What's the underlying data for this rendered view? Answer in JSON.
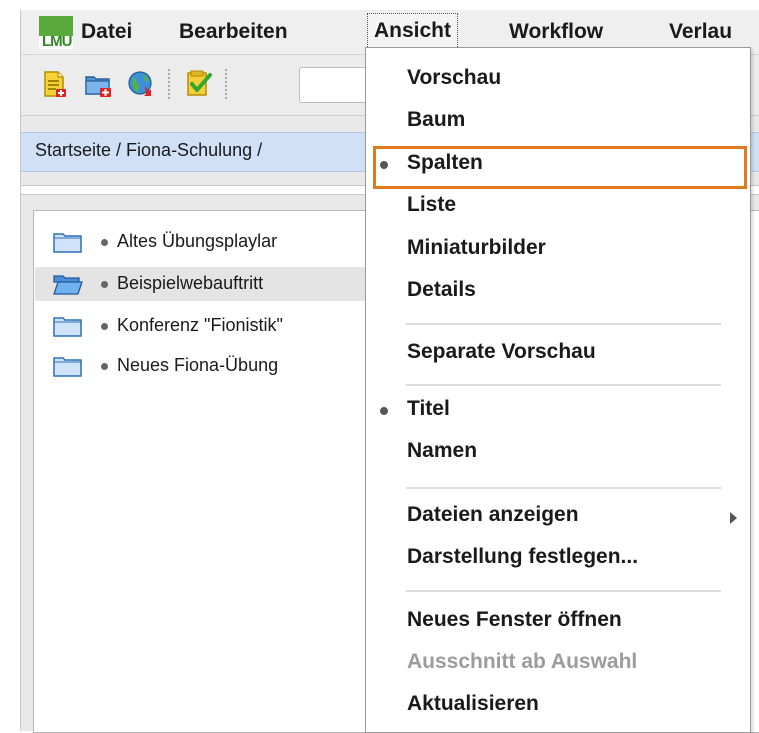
{
  "app": {
    "logo_text": "LMU"
  },
  "menubar": {
    "items": [
      {
        "label": "Datei"
      },
      {
        "label": "Bearbeiten"
      },
      {
        "label": "Ansicht"
      },
      {
        "label": "Workflow"
      },
      {
        "label": "Verlau"
      }
    ],
    "active": "Ansicht"
  },
  "toolbar": {
    "icons": [
      "new-document-icon",
      "new-folder-icon",
      "publish-globe-icon",
      "approve-checkmark-icon"
    ],
    "search_value": ""
  },
  "breadcrumb": {
    "text": "Startseite / Fiona-Schulung /"
  },
  "tree": {
    "items": [
      {
        "label": "Altes Übungsplaylar",
        "selected": false
      },
      {
        "label": "Beispielwebauftritt",
        "selected": true
      },
      {
        "label": "Konferenz \"Fionistik\"",
        "selected": false
      },
      {
        "label": "Neues Fiona-Übung",
        "selected": false
      }
    ]
  },
  "dropdown": {
    "items": [
      {
        "label": "Vorschau",
        "checked": false
      },
      {
        "label": "Baum",
        "checked": false
      },
      {
        "label": "Spalten",
        "checked": true,
        "highlighted": true
      },
      {
        "label": "Liste",
        "checked": false
      },
      {
        "label": "Miniaturbilder",
        "checked": false
      },
      {
        "label": "Details",
        "checked": false
      },
      {
        "label": "Separate Vorschau",
        "checked": false
      },
      {
        "label": "Titel",
        "checked": true
      },
      {
        "label": "Namen",
        "checked": false
      },
      {
        "label": "Dateien anzeigen",
        "submenu": true
      },
      {
        "label": "Darstellung festlegen..."
      },
      {
        "label": "Neues Fenster öffnen"
      },
      {
        "label": "Ausschnitt ab Auswahl",
        "disabled": true
      },
      {
        "label": "Aktualisieren"
      }
    ]
  },
  "colors": {
    "highlight_border": "#e07a1c",
    "breadcrumb_bg": "#cfe0f7",
    "logo_green": "#5aa93b",
    "folder_blue": "#5a9fe0"
  }
}
